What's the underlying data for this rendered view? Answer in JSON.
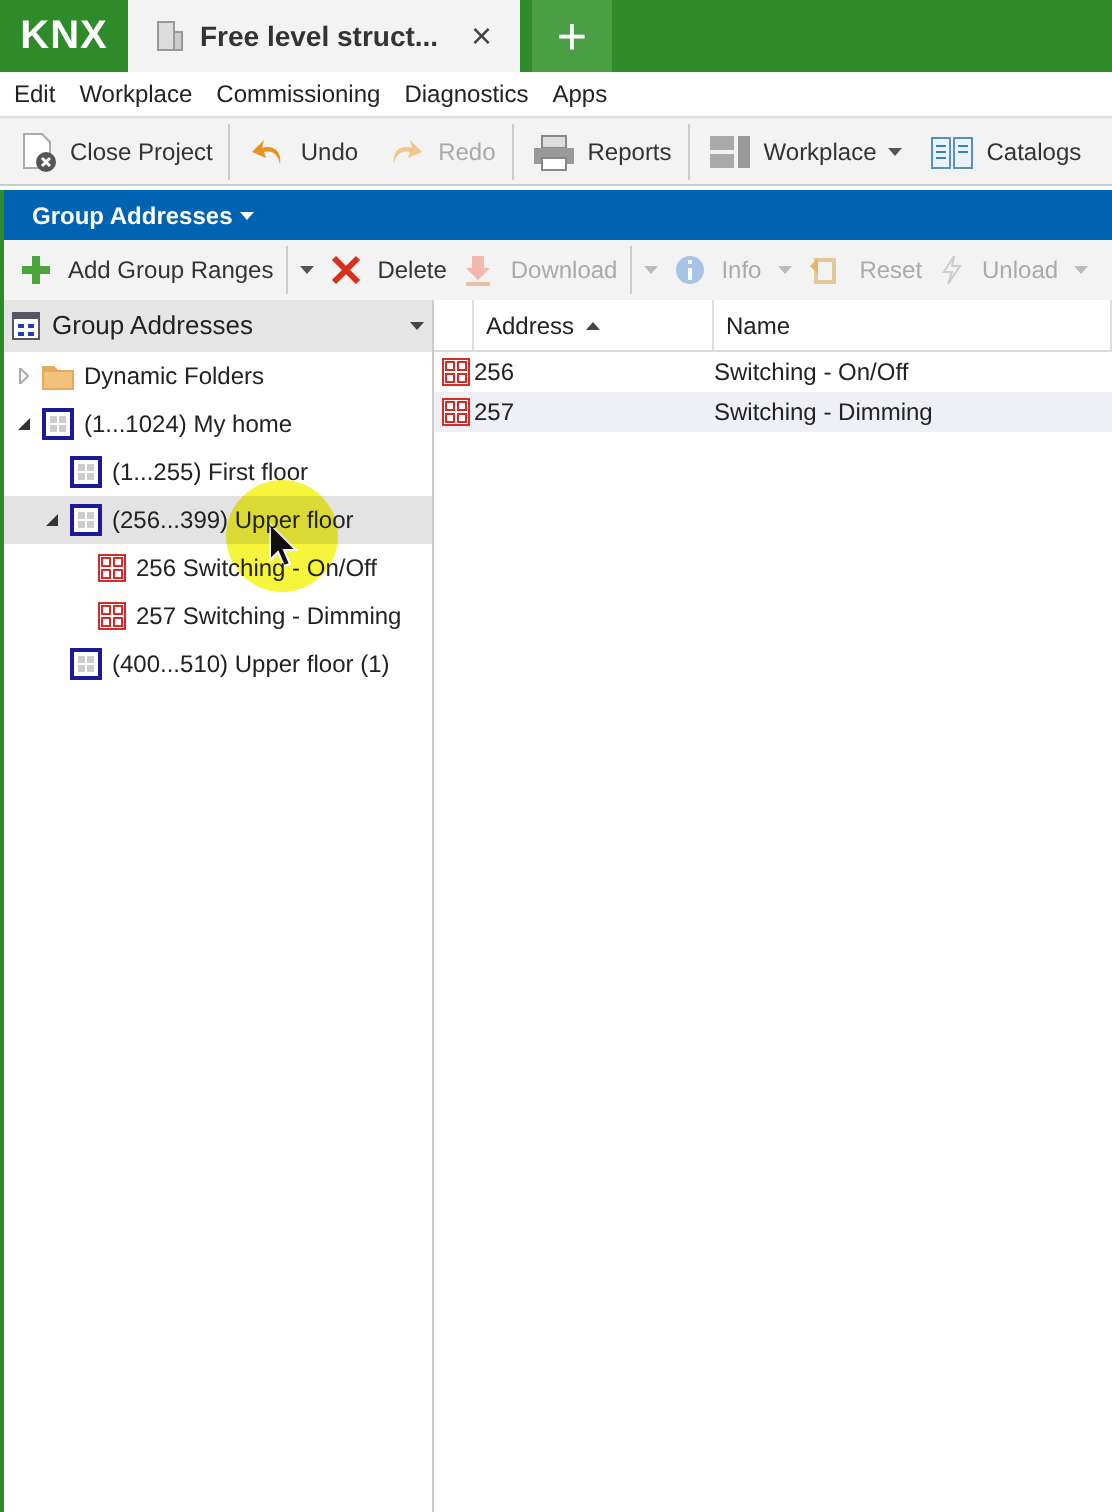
{
  "app_bar": {
    "logo": "KNX",
    "tabs": [
      {
        "label": "Free level struct...",
        "selected": true,
        "close": "×"
      }
    ],
    "new_tab": "+"
  },
  "menu": [
    "Edit",
    "Workplace",
    "Commissioning",
    "Diagnostics",
    "Apps"
  ],
  "toolbar": [
    {
      "label": "Close Project",
      "kind": "close-project",
      "disabled": false,
      "dropdown": false,
      "separator_after": true
    },
    {
      "label": "Undo",
      "kind": "undo",
      "disabled": false,
      "dropdown": false,
      "separator_after": false
    },
    {
      "label": "Redo",
      "kind": "redo",
      "disabled": true,
      "dropdown": false,
      "separator_after": true
    },
    {
      "label": "Reports",
      "kind": "printer",
      "disabled": false,
      "dropdown": false,
      "separator_after": true
    },
    {
      "label": "Workplace",
      "kind": "layout",
      "disabled": false,
      "dropdown": true,
      "separator_after": false
    },
    {
      "label": "Catalogs",
      "kind": "book",
      "disabled": false,
      "dropdown": false,
      "separator_after": false
    }
  ],
  "panel_title": "Group Addresses",
  "actions": [
    {
      "label": "Add Group Ranges",
      "kind": "plus",
      "disabled": false,
      "split": true,
      "dropdown": false
    },
    {
      "label": "Delete",
      "kind": "delete",
      "disabled": false,
      "split": false,
      "dropdown": false
    },
    {
      "label": "Download",
      "kind": "download",
      "disabled": true,
      "split": true,
      "dropdown": false
    },
    {
      "label": "Info",
      "kind": "info",
      "disabled": true,
      "split": false,
      "dropdown": true
    },
    {
      "label": "Reset",
      "kind": "reset",
      "disabled": true,
      "split": false,
      "dropdown": false
    },
    {
      "label": "Unload",
      "kind": "unload",
      "disabled": true,
      "split": false,
      "dropdown": true
    }
  ],
  "tree": {
    "title": "Group Addresses",
    "items": [
      {
        "label": "Dynamic Folders",
        "kind": "folder",
        "expanded": false,
        "selected": false
      },
      {
        "label": "(1...1024) My home",
        "kind": "range",
        "expanded": true,
        "selected": false,
        "children": [
          {
            "label": "(1...255) First floor",
            "kind": "range",
            "selected": false
          },
          {
            "label": "(256...399) Upper floor",
            "kind": "range",
            "expanded": true,
            "selected": true,
            "children": [
              {
                "label": "256 Switching - On/Off",
                "kind": "address",
                "selected": false
              },
              {
                "label": "257 Switching - Dimming",
                "kind": "address",
                "selected": false
              }
            ]
          },
          {
            "label": "(400...510) Upper floor (1)",
            "kind": "range",
            "selected": false
          }
        ]
      }
    ]
  },
  "table": {
    "columns": [
      {
        "label": "Address",
        "sorted": true
      },
      {
        "label": "Name",
        "sorted": false
      }
    ],
    "rows": [
      {
        "address": "256",
        "name": "Switching - On/Off",
        "selected": false
      },
      {
        "address": "257",
        "name": "Switching - Dimming",
        "selected": true
      }
    ]
  }
}
